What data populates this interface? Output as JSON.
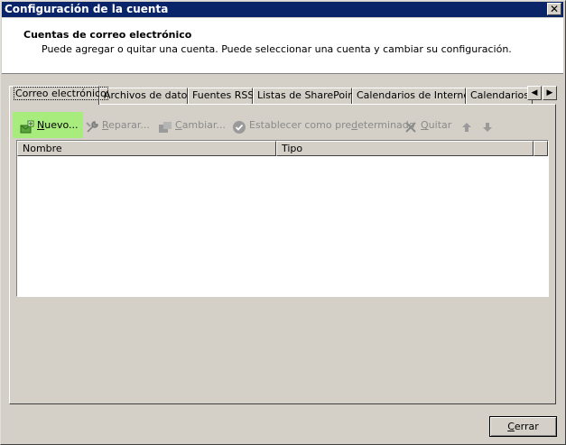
{
  "window": {
    "title": "Configuración de la cuenta",
    "close_glyph": "✕"
  },
  "header": {
    "title": "Cuentas de correo electrónico",
    "description": "Puede agregar o quitar una cuenta. Puede seleccionar una cuenta y cambiar su configuración."
  },
  "tabs": [
    {
      "label": "Correo electrónico",
      "active": true
    },
    {
      "label": "Archivos de datos"
    },
    {
      "label": "Fuentes RSS"
    },
    {
      "label": "Listas de SharePoint"
    },
    {
      "label": "Calendarios de Internet"
    },
    {
      "label": "Calendarios p"
    }
  ],
  "toolbar": {
    "new": {
      "prefix": "",
      "mnemonic": "N",
      "suffix": "uevo...",
      "icon": "new-account-icon"
    },
    "repair": {
      "mnemonic": "R",
      "suffix": "eparar...",
      "icon": "wrench-icon"
    },
    "change": {
      "mnemonic": "C",
      "suffix": "ambiar...",
      "icon": "change-icon"
    },
    "set_default": {
      "prefix": "Establecer como pre",
      "mnemonic": "d",
      "suffix": "eterminado",
      "icon": "check-circle-icon"
    },
    "remove": {
      "mnemonic": "Q",
      "suffix": "uitar",
      "icon": "x-icon"
    },
    "move_up_icon": "arrow-up-icon",
    "move_down_icon": "arrow-down-icon"
  },
  "table": {
    "columns": [
      "Nombre",
      "Tipo"
    ],
    "rows": []
  },
  "footer": {
    "close_mnemonic": "C",
    "close_suffix": "errar"
  },
  "colors": {
    "titlebar": "#0a246a",
    "new_highlight": "#a7ec7c",
    "dialog_bg": "#d4d0c8"
  }
}
